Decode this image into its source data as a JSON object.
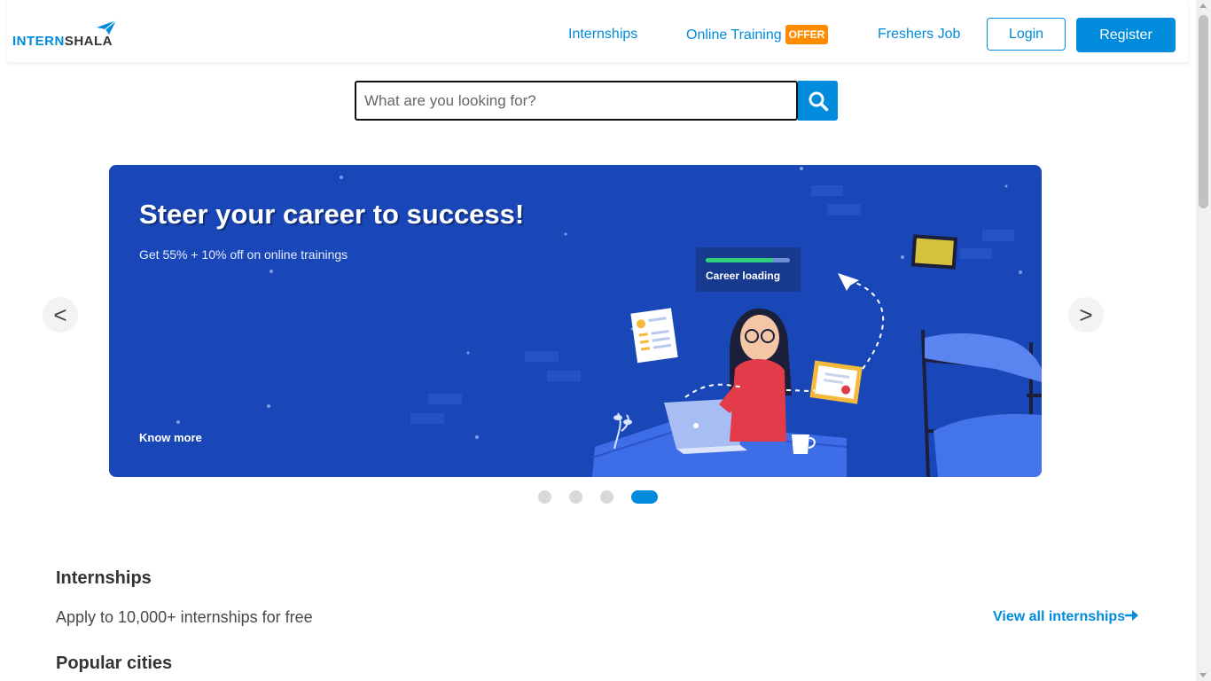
{
  "header": {
    "logo_text_1": "INTERN",
    "logo_text_2": "SHALA",
    "nav": {
      "internships": "Internships",
      "online_training": "Online Training",
      "offer_badge": "OFFER",
      "freshers_job": "Freshers Job"
    },
    "login": "Login",
    "register": "Register"
  },
  "search": {
    "placeholder": "What are you looking for?",
    "icon": "search-icon"
  },
  "carousel": {
    "prev": "<",
    "next": ">",
    "banner": {
      "title": "Steer your career to success!",
      "subtitle": "Get 55% + 10% off on online trainings",
      "cta": "Know more",
      "loading_label": "Career loading",
      "loading_progress": 0.8
    },
    "dots_count": 4,
    "active_dot": 4
  },
  "internships_section": {
    "title": "Internships",
    "subtitle": "Apply to 10,000+ internships for free",
    "view_all": "View all internships"
  },
  "popular_cities": {
    "title": "Popular cities"
  },
  "colors": {
    "brand": "#008bdc",
    "offer": "#ff8c00",
    "banner_bg": "#1a47b8"
  }
}
